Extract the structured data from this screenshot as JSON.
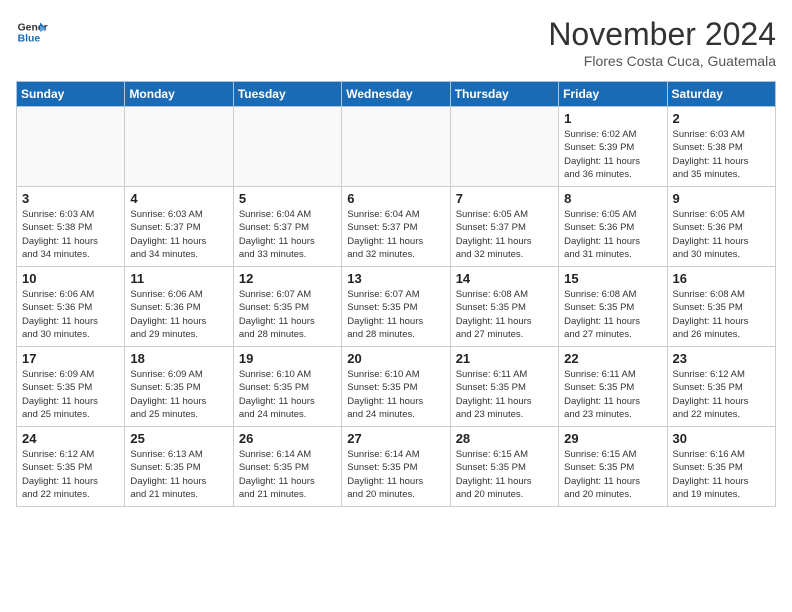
{
  "header": {
    "logo_line1": "General",
    "logo_line2": "Blue",
    "month": "November 2024",
    "location": "Flores Costa Cuca, Guatemala"
  },
  "days_header": [
    "Sunday",
    "Monday",
    "Tuesday",
    "Wednesday",
    "Thursday",
    "Friday",
    "Saturday"
  ],
  "weeks": [
    [
      {
        "num": "",
        "info": "",
        "empty": true
      },
      {
        "num": "",
        "info": "",
        "empty": true
      },
      {
        "num": "",
        "info": "",
        "empty": true
      },
      {
        "num": "",
        "info": "",
        "empty": true
      },
      {
        "num": "",
        "info": "",
        "empty": true
      },
      {
        "num": "1",
        "info": "Sunrise: 6:02 AM\nSunset: 5:39 PM\nDaylight: 11 hours\nand 36 minutes.",
        "empty": false
      },
      {
        "num": "2",
        "info": "Sunrise: 6:03 AM\nSunset: 5:38 PM\nDaylight: 11 hours\nand 35 minutes.",
        "empty": false
      }
    ],
    [
      {
        "num": "3",
        "info": "Sunrise: 6:03 AM\nSunset: 5:38 PM\nDaylight: 11 hours\nand 34 minutes.",
        "empty": false
      },
      {
        "num": "4",
        "info": "Sunrise: 6:03 AM\nSunset: 5:37 PM\nDaylight: 11 hours\nand 34 minutes.",
        "empty": false
      },
      {
        "num": "5",
        "info": "Sunrise: 6:04 AM\nSunset: 5:37 PM\nDaylight: 11 hours\nand 33 minutes.",
        "empty": false
      },
      {
        "num": "6",
        "info": "Sunrise: 6:04 AM\nSunset: 5:37 PM\nDaylight: 11 hours\nand 32 minutes.",
        "empty": false
      },
      {
        "num": "7",
        "info": "Sunrise: 6:05 AM\nSunset: 5:37 PM\nDaylight: 11 hours\nand 32 minutes.",
        "empty": false
      },
      {
        "num": "8",
        "info": "Sunrise: 6:05 AM\nSunset: 5:36 PM\nDaylight: 11 hours\nand 31 minutes.",
        "empty": false
      },
      {
        "num": "9",
        "info": "Sunrise: 6:05 AM\nSunset: 5:36 PM\nDaylight: 11 hours\nand 30 minutes.",
        "empty": false
      }
    ],
    [
      {
        "num": "10",
        "info": "Sunrise: 6:06 AM\nSunset: 5:36 PM\nDaylight: 11 hours\nand 30 minutes.",
        "empty": false
      },
      {
        "num": "11",
        "info": "Sunrise: 6:06 AM\nSunset: 5:36 PM\nDaylight: 11 hours\nand 29 minutes.",
        "empty": false
      },
      {
        "num": "12",
        "info": "Sunrise: 6:07 AM\nSunset: 5:35 PM\nDaylight: 11 hours\nand 28 minutes.",
        "empty": false
      },
      {
        "num": "13",
        "info": "Sunrise: 6:07 AM\nSunset: 5:35 PM\nDaylight: 11 hours\nand 28 minutes.",
        "empty": false
      },
      {
        "num": "14",
        "info": "Sunrise: 6:08 AM\nSunset: 5:35 PM\nDaylight: 11 hours\nand 27 minutes.",
        "empty": false
      },
      {
        "num": "15",
        "info": "Sunrise: 6:08 AM\nSunset: 5:35 PM\nDaylight: 11 hours\nand 27 minutes.",
        "empty": false
      },
      {
        "num": "16",
        "info": "Sunrise: 6:08 AM\nSunset: 5:35 PM\nDaylight: 11 hours\nand 26 minutes.",
        "empty": false
      }
    ],
    [
      {
        "num": "17",
        "info": "Sunrise: 6:09 AM\nSunset: 5:35 PM\nDaylight: 11 hours\nand 25 minutes.",
        "empty": false
      },
      {
        "num": "18",
        "info": "Sunrise: 6:09 AM\nSunset: 5:35 PM\nDaylight: 11 hours\nand 25 minutes.",
        "empty": false
      },
      {
        "num": "19",
        "info": "Sunrise: 6:10 AM\nSunset: 5:35 PM\nDaylight: 11 hours\nand 24 minutes.",
        "empty": false
      },
      {
        "num": "20",
        "info": "Sunrise: 6:10 AM\nSunset: 5:35 PM\nDaylight: 11 hours\nand 24 minutes.",
        "empty": false
      },
      {
        "num": "21",
        "info": "Sunrise: 6:11 AM\nSunset: 5:35 PM\nDaylight: 11 hours\nand 23 minutes.",
        "empty": false
      },
      {
        "num": "22",
        "info": "Sunrise: 6:11 AM\nSunset: 5:35 PM\nDaylight: 11 hours\nand 23 minutes.",
        "empty": false
      },
      {
        "num": "23",
        "info": "Sunrise: 6:12 AM\nSunset: 5:35 PM\nDaylight: 11 hours\nand 22 minutes.",
        "empty": false
      }
    ],
    [
      {
        "num": "24",
        "info": "Sunrise: 6:12 AM\nSunset: 5:35 PM\nDaylight: 11 hours\nand 22 minutes.",
        "empty": false
      },
      {
        "num": "25",
        "info": "Sunrise: 6:13 AM\nSunset: 5:35 PM\nDaylight: 11 hours\nand 21 minutes.",
        "empty": false
      },
      {
        "num": "26",
        "info": "Sunrise: 6:14 AM\nSunset: 5:35 PM\nDaylight: 11 hours\nand 21 minutes.",
        "empty": false
      },
      {
        "num": "27",
        "info": "Sunrise: 6:14 AM\nSunset: 5:35 PM\nDaylight: 11 hours\nand 20 minutes.",
        "empty": false
      },
      {
        "num": "28",
        "info": "Sunrise: 6:15 AM\nSunset: 5:35 PM\nDaylight: 11 hours\nand 20 minutes.",
        "empty": false
      },
      {
        "num": "29",
        "info": "Sunrise: 6:15 AM\nSunset: 5:35 PM\nDaylight: 11 hours\nand 20 minutes.",
        "empty": false
      },
      {
        "num": "30",
        "info": "Sunrise: 6:16 AM\nSunset: 5:35 PM\nDaylight: 11 hours\nand 19 minutes.",
        "empty": false
      }
    ]
  ]
}
